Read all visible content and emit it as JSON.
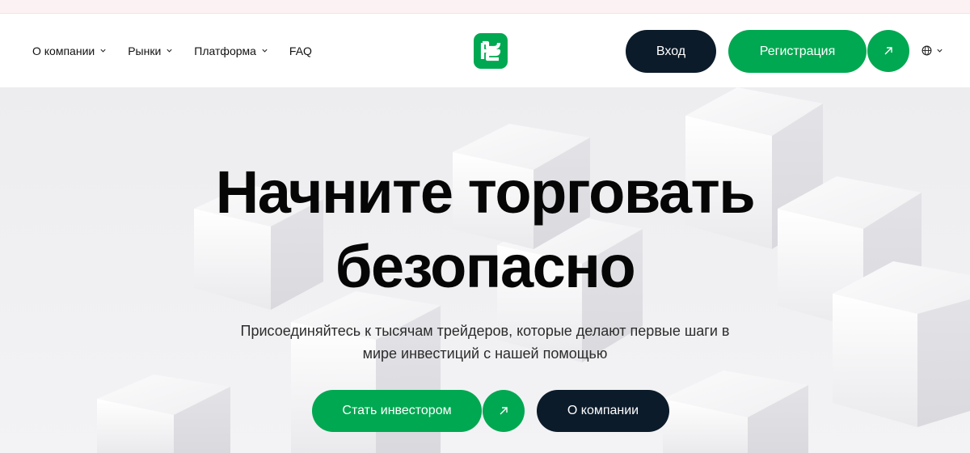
{
  "nav": {
    "items": [
      {
        "label": "О компании",
        "has_dropdown": true
      },
      {
        "label": "Рынки",
        "has_dropdown": true
      },
      {
        "label": "Платформа",
        "has_dropdown": true
      },
      {
        "label": "FAQ",
        "has_dropdown": false
      }
    ]
  },
  "header": {
    "login_label": "Вход",
    "register_label": "Регистрация",
    "language_icon": "globe-icon"
  },
  "hero": {
    "title_line1": "Начните торговать",
    "title_line2": "безопасно",
    "subtitle_line1": "Присоединяйтесь к тысячам трейдеров, которые делают первые шаги в",
    "subtitle_line2": "мире инвестиций с нашей помощью",
    "primary_cta": "Стать инвестором",
    "secondary_cta": "О компании"
  },
  "colors": {
    "brand_green": "#00a851",
    "dark_navy": "#0c1b2a",
    "hero_bg": "#efeff2",
    "top_strip": "#fcf2f4"
  }
}
